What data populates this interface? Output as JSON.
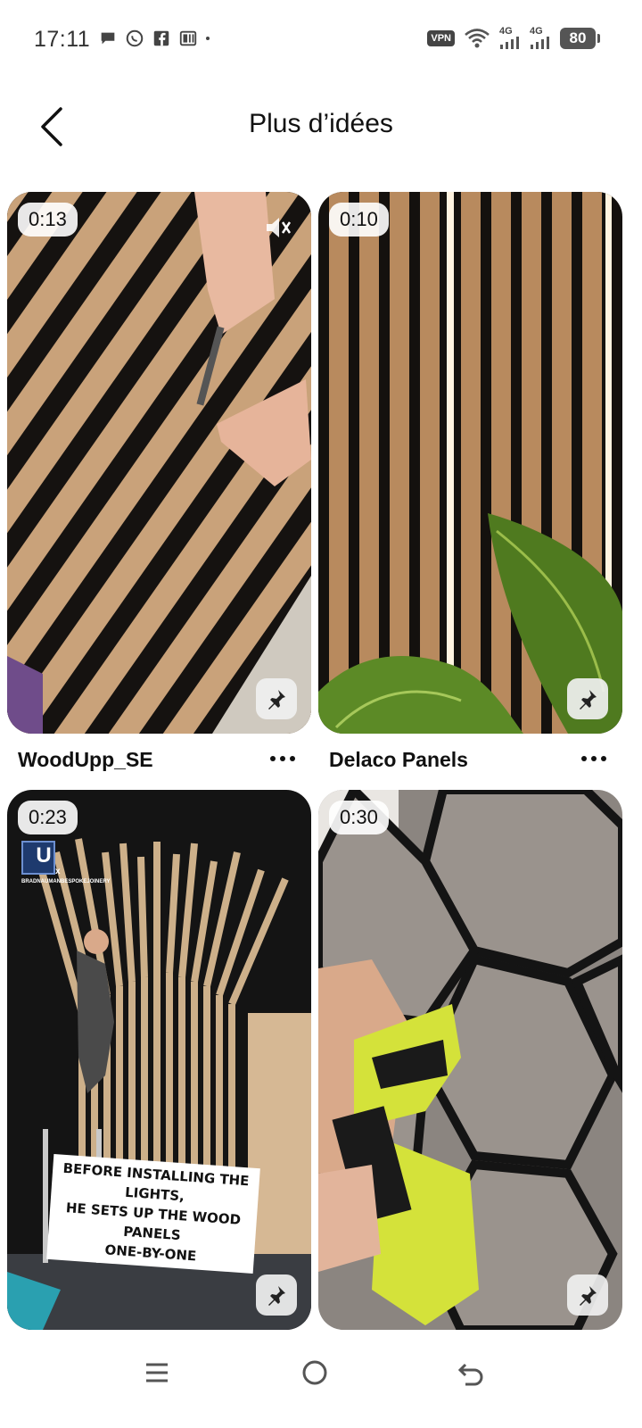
{
  "status_bar": {
    "time": "17:11",
    "left_icons": [
      "message-icon",
      "whatsapp-icon",
      "facebook-icon",
      "app-icon",
      "dot-icon"
    ],
    "vpn": "VPN",
    "sig1": "4G",
    "sig2": "4G",
    "battery": "80"
  },
  "header": {
    "title": "Plus d’idées"
  },
  "pins": [
    {
      "duration": "0:13",
      "author": "WoodUpp_SE",
      "muted": true
    },
    {
      "duration": "0:10",
      "author": "Delaco Panels",
      "muted": false
    },
    {
      "duration": "0:23",
      "author": "",
      "overlay": [
        "BEFORE INSTALLING THE LIGHTS,",
        "HE SETS UP THE WOOD PANELS",
        "ONE-BY-ONE"
      ],
      "brand": "U",
      "brand_x": "x",
      "brand_caption": "BRADNAUMANBESPOKEJOINERY"
    },
    {
      "duration": "0:30",
      "author": ""
    }
  ],
  "colors": {
    "wood": "#c9a27a",
    "dark": "#1a1714",
    "lime": "#d4e23a"
  }
}
